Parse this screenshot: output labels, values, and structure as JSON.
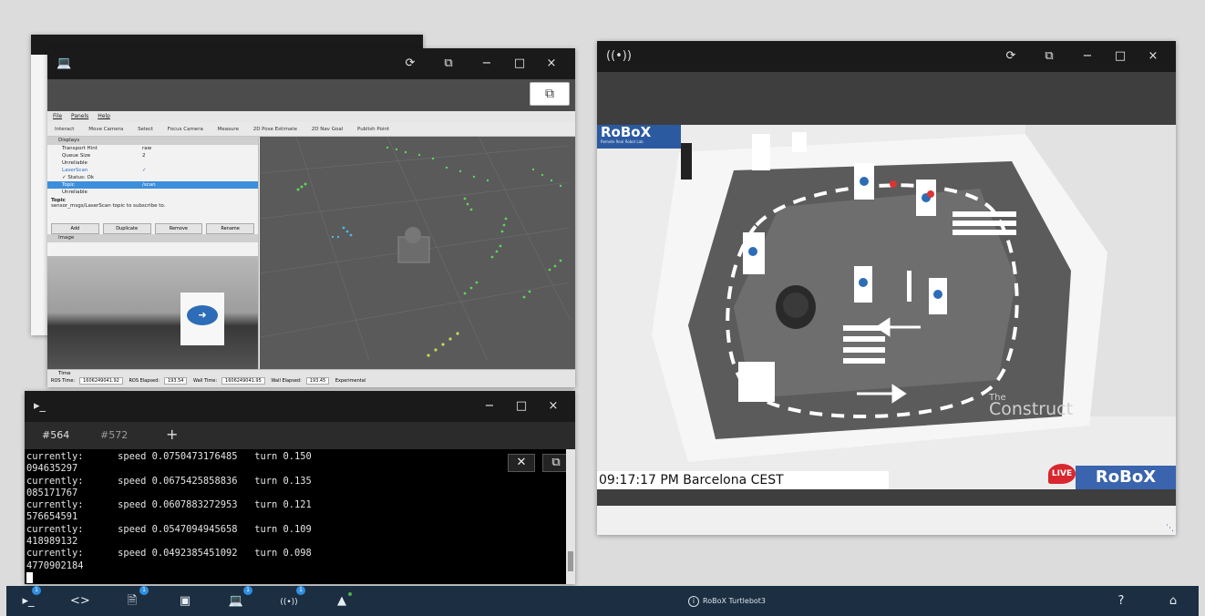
{
  "back_window": {},
  "rviz_window": {
    "popout_icon": "popout-icon",
    "menu": [
      "File",
      "Panels",
      "Help"
    ],
    "toolbar": [
      "Interact",
      "Move Camera",
      "Select",
      "Focus Camera",
      "Measure",
      "2D Pose Estimate",
      "2D Nav Goal",
      "Publish Point"
    ],
    "displays_header": "Displays",
    "display_rows": [
      {
        "label": "Transport Hint",
        "value": "raw"
      },
      {
        "label": "Queue Size",
        "value": "2"
      },
      {
        "label": "Unreliable",
        "value": ""
      },
      {
        "label": "LaserScan",
        "value": "✓"
      },
      {
        "label": "✓ Status: Ok",
        "value": ""
      },
      {
        "label": "Topic",
        "value": "/scan"
      },
      {
        "label": "Unreliable",
        "value": ""
      }
    ],
    "topic_title": "Topic",
    "topic_desc": "sensor_msgs/LaserScan topic to subscribe to.",
    "buttons": [
      "Add",
      "Duplicate",
      "Remove",
      "Rename"
    ],
    "image_header": "Image",
    "time_header": "Time",
    "status": {
      "ros_time_label": "ROS Time:",
      "ros_time": "1606249041.92",
      "ros_elapsed_label": "ROS Elapsed:",
      "ros_elapsed": "193.54",
      "wall_time_label": "Wall Time:",
      "wall_time": "1606249041.95",
      "wall_elapsed_label": "Wall Elapsed:",
      "wall_elapsed": "193.45",
      "experimental": "Experimental"
    }
  },
  "terminal": {
    "tabs": [
      "#564",
      "#572"
    ],
    "add_tab": "+",
    "close_label": "✕",
    "lines": [
      "currently:      speed 0.0750473176485   turn 0.150",
      "094635297",
      "currently:      speed 0.0675425858836   turn 0.135",
      "085171767",
      "currently:      speed 0.0607883272953   turn 0.121",
      "576654591",
      "currently:      speed 0.0547094945658   turn 0.109",
      "418989132",
      "currently:      speed 0.0492385451092   turn 0.098",
      "4770902184"
    ]
  },
  "camera_window": {
    "logo_top": "RoBoX",
    "logo_top_sub": "Remote Real Robot Lab",
    "timestamp": "09:17:17 PM Barcelona CEST",
    "live": "LIVE",
    "logo_bottom": "RoBoX",
    "construct_the": "The",
    "construct_name": "Construct"
  },
  "window_controls": {
    "refresh": "⟳",
    "restore": "⧉",
    "minimize": "−",
    "maximize": "□",
    "close": "×"
  },
  "taskbar": {
    "center_label": "RoBoX Turtlebot3",
    "help": "?",
    "home": "⌂",
    "badges": [
      "1",
      "1",
      "1",
      "1"
    ],
    "colors": {
      "bg": "#1c2e42",
      "badge": "#2f8fe0"
    }
  }
}
